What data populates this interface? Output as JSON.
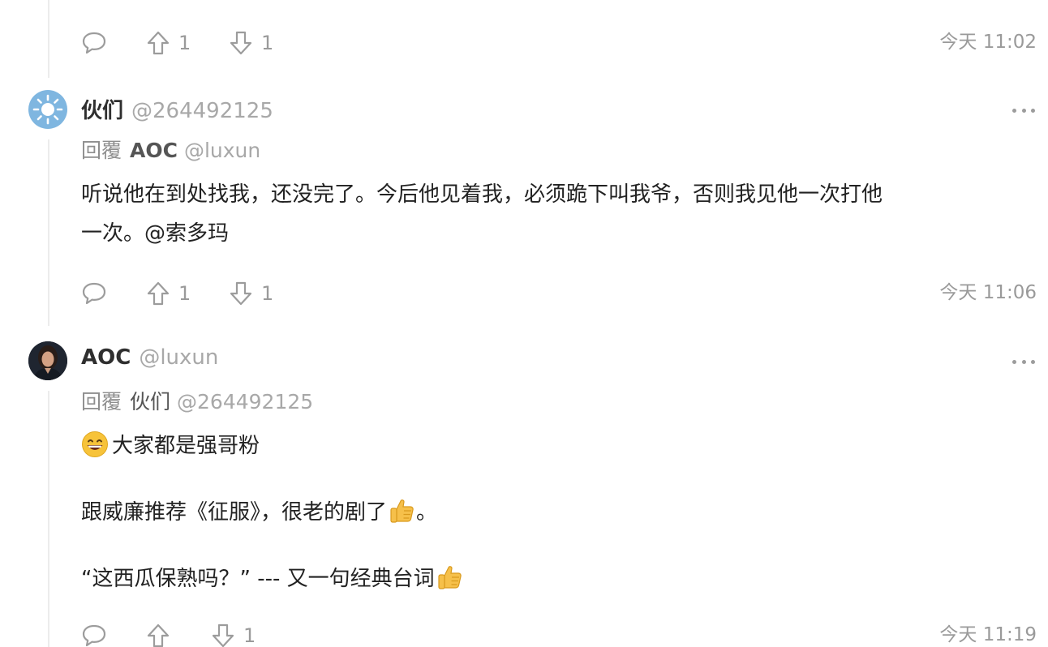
{
  "colors": {
    "muted": "#9a9a9a",
    "text": "#222222",
    "avatar_sun_bg": "#7fb6e0",
    "thread_line": "#ececec"
  },
  "top_actions": {
    "upvotes": "1",
    "downvotes": "1",
    "timestamp": "今天 11:02"
  },
  "comments": [
    {
      "avatar_icon": "sun-avatar",
      "username": "伙们",
      "handle": "@264492125",
      "reply_label": "回覆",
      "reply_to_name": "AOC",
      "reply_to_handle": "@luxun",
      "body_line1": "听说他在到处找我，还没完了。今后他见着我，必须跪下叫我爷，否则我见他一次打他",
      "body_line2": "一次。@索多玛",
      "upvotes": "1",
      "downvotes": "1",
      "timestamp": "今天 11:06"
    },
    {
      "avatar_icon": "portrait-avatar",
      "username": "AOC",
      "handle": "@luxun",
      "reply_label": "回覆",
      "reply_to_name": "伙们",
      "reply_to_handle": "@264492125",
      "paragraph1": "大家都是强哥粉",
      "paragraph2": "跟威廉推荐《征服》，很老的剧了",
      "paragraph2_end": "。",
      "paragraph3": "“这西瓜保熟吗？” --- 又一句经典台词",
      "upvotes": "",
      "downvotes": "1",
      "timestamp": "今天 11:19"
    }
  ]
}
